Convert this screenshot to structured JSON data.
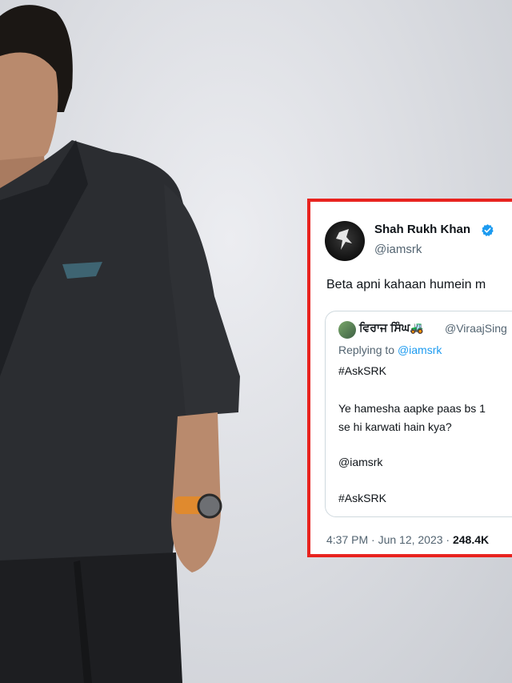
{
  "tweet": {
    "author_name": "Shah Rukh Khan",
    "handle": "@iamsrk",
    "text": "Beta apni kahaan humein m",
    "quoted": {
      "name": "ਵਿਰਾਜ ਸਿੰਘ",
      "emoji": "🚜",
      "handle": "@ViraajSing",
      "reply_prefix": "Replying to ",
      "reply_mention": "@iamsrk",
      "lines": [
        "#AskSRK",
        "Ye hamesha aapke paas bs 1",
        "se hi karwati hain kya?",
        "@iamsrk",
        "#AskSRK"
      ]
    },
    "time": "4:37 PM · Jun 12, 2023 ·",
    "views": "248.4K"
  },
  "colors": {
    "highlight_border": "#e8231f",
    "link": "#1d9bf0",
    "verified": "#1d9bf0"
  }
}
